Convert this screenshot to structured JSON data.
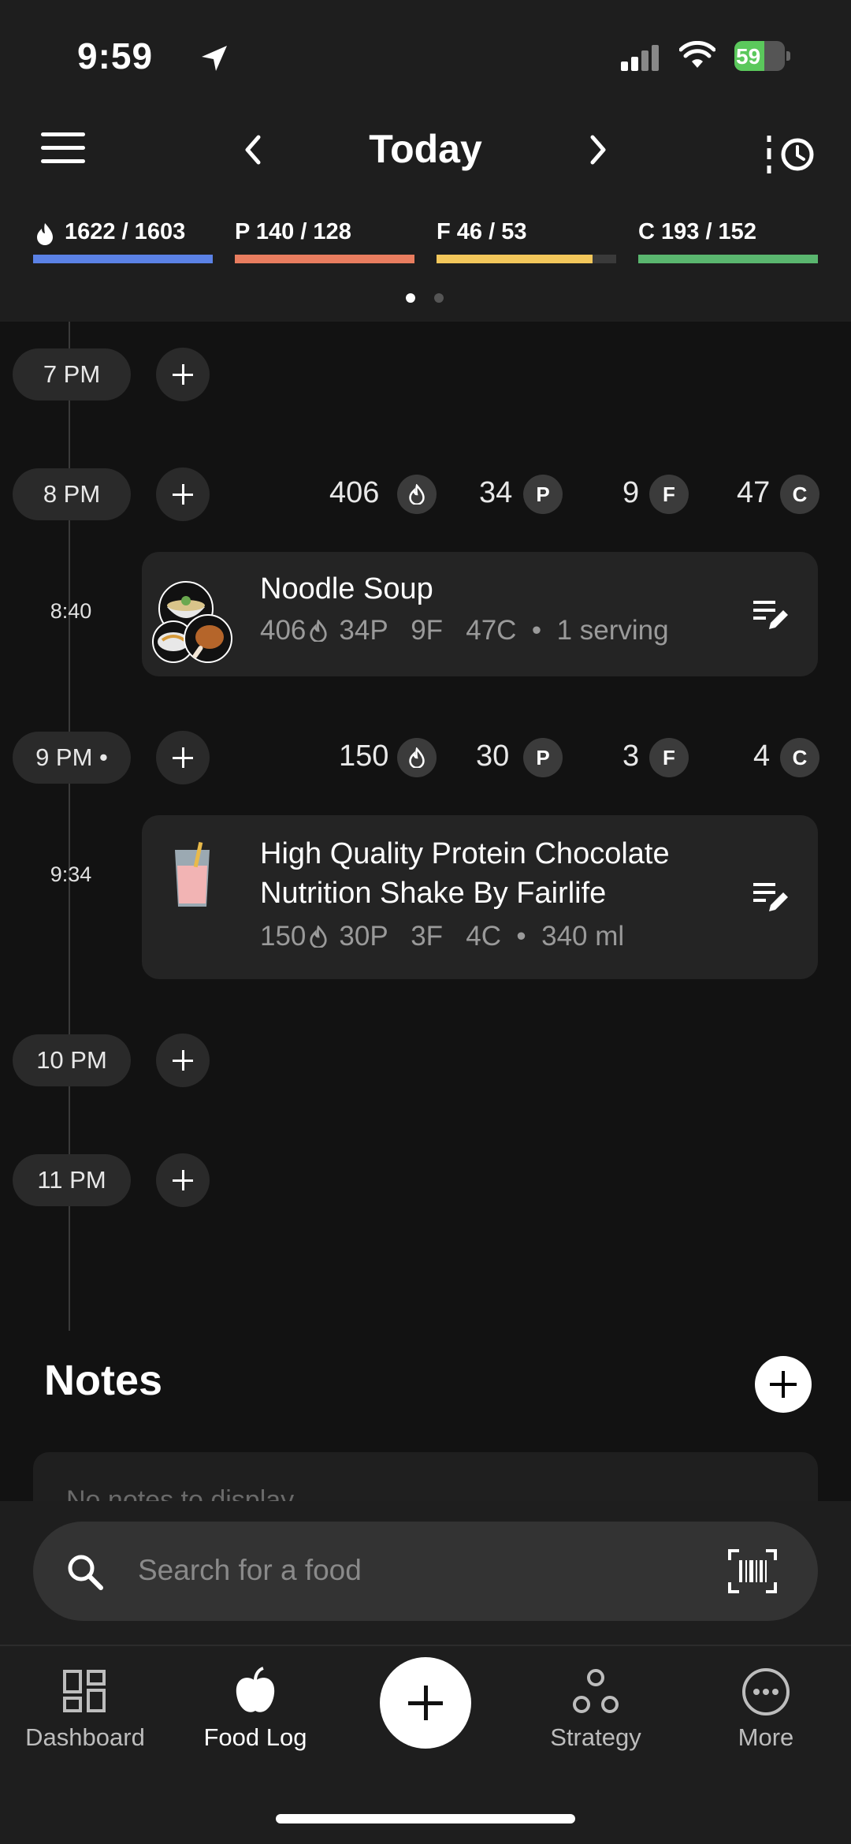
{
  "status_bar": {
    "time": "9:59",
    "battery": "59",
    "battery_level": 0.59
  },
  "header": {
    "title": "Today"
  },
  "macros": {
    "calories": {
      "label": "1622 / 1603",
      "progress": 1.0,
      "color": "#5b82e6"
    },
    "protein": {
      "label": "P 140 / 128",
      "progress": 1.0,
      "color": "#e97d5f"
    },
    "fat": {
      "label": "F 46 / 53",
      "progress": 0.87,
      "color": "#f3c75b"
    },
    "carbs": {
      "label": "C 193 / 152",
      "progress": 1.0,
      "color": "#5ab66f"
    }
  },
  "timeline": {
    "hours": [
      "7 PM",
      "8 PM",
      "9 PM",
      "10 PM",
      "11 PM"
    ],
    "totals": [
      {
        "cal": "406",
        "p": "34",
        "f": "9",
        "c": "47"
      },
      {
        "cal": "150",
        "p": "30",
        "f": "3",
        "c": "4"
      }
    ],
    "badges": {
      "p": "P",
      "f": "F",
      "c": "C"
    },
    "entries": [
      {
        "time": "8:40",
        "name": "Noodle Soup",
        "cal": "406",
        "macros": "34P   9F   47C  •  1 serving"
      },
      {
        "time": "9:34",
        "name_line1": "High Quality Protein Chocolate",
        "name_line2": "Nutrition Shake By Fairlife",
        "cal": "150",
        "macros": "30P   3F   4C  •  340 ml"
      }
    ]
  },
  "notes": {
    "title": "Notes",
    "empty": "No notes to display"
  },
  "search": {
    "placeholder": "Search for a food"
  },
  "tabs": {
    "dashboard": "Dashboard",
    "food_log": "Food Log",
    "strategy": "Strategy",
    "more": "More"
  }
}
